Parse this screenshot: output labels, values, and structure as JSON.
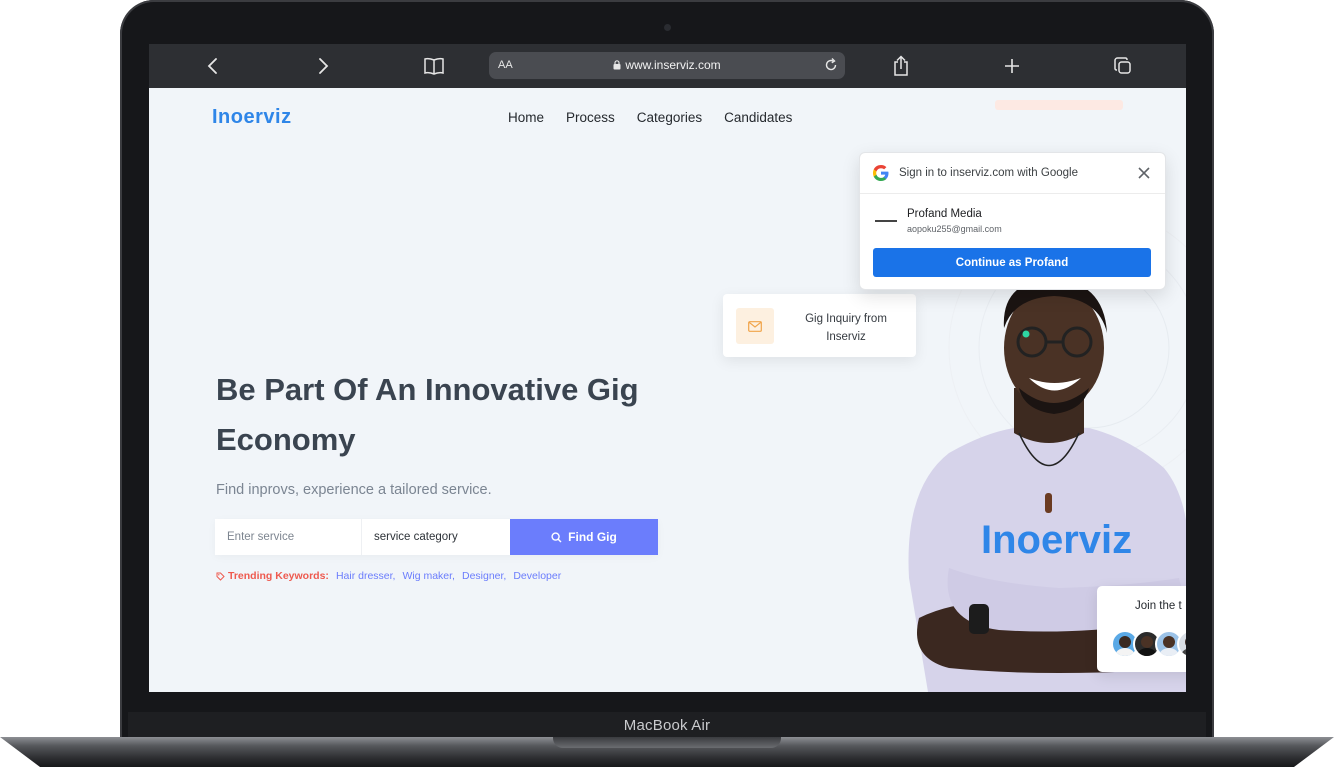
{
  "device": {
    "model_label": "MacBook Air"
  },
  "browser": {
    "text_size_label": "AA",
    "url": "www.inserviz.com",
    "icons": [
      "back-icon",
      "forward-icon",
      "bookmarks-icon",
      "lock-icon",
      "reload-icon",
      "share-icon",
      "new-tab-icon",
      "tabs-overview-icon"
    ]
  },
  "site": {
    "logo": "Inoerviz",
    "nav": [
      "Home",
      "Process",
      "Categories",
      "Candidates"
    ],
    "hero": {
      "title": "Be Part Of An Innovative Gig Economy",
      "subtitle": "Find inprovs, experience a tailored service."
    },
    "search": {
      "service_placeholder": "Enter service",
      "category_value": "service category",
      "button_label": "Find Gig"
    },
    "trending": {
      "label": "Trending Keywords:",
      "keywords": [
        "Hair dresser,",
        "Wig maker,",
        "Designer,",
        "Developer"
      ]
    },
    "inquiry_card": {
      "text": "Gig Inquiry from Inserviz"
    },
    "join_card": {
      "text": "Join the t"
    },
    "shirt_text": "Inoerviz"
  },
  "google_popup": {
    "title": "Sign in to inserviz.com with Google",
    "account_name": "Profand Media",
    "account_email": "aopoku255@gmail.com",
    "continue_label": "Continue as Profand"
  },
  "colors": {
    "accent": "#6b7dfc",
    "logo_blue": "#2f86e8",
    "trending_red": "#ee5a4f",
    "google_blue": "#1a73e8",
    "page_bg": "#f1f5f9"
  }
}
